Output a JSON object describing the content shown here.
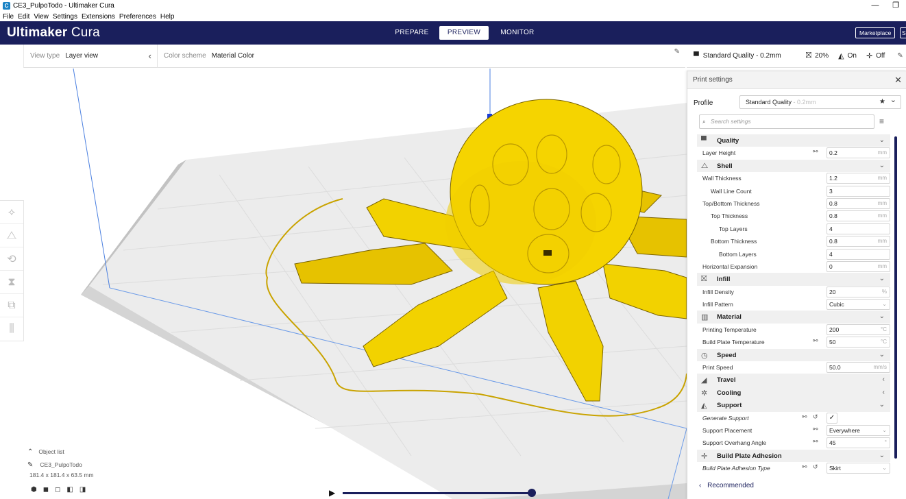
{
  "window": {
    "title": "CE3_PulpoTodo - Ultimaker Cura",
    "app_icon": "C",
    "minimize": "—",
    "restore": "❐"
  },
  "menu": [
    "File",
    "Edit",
    "View",
    "Settings",
    "Extensions",
    "Preferences",
    "Help"
  ],
  "header": {
    "logo_bold": "Ultimaker",
    "logo_light": " Cura",
    "stages": [
      "PREPARE",
      "PREVIEW",
      "MONITOR"
    ],
    "active_stage": "PREVIEW",
    "marketplace": "Marketplace",
    "signin": "S",
    "colors": {
      "bar": "#1a1f5c"
    }
  },
  "viewbar": {
    "view_type_label": "View type",
    "view_type_value": "Layer view",
    "chevron": "‹",
    "color_scheme_label": "Color scheme",
    "color_scheme_value": "Material Color",
    "edit_icon": "✎"
  },
  "quality_bar": {
    "profile": "Standard Quality - 0.2mm",
    "infill": "20%",
    "support": "On",
    "adhesion": "Off",
    "edit_icon": "✎"
  },
  "panel": {
    "title": "Print settings",
    "close": "✕",
    "profile_label": "Profile",
    "profile_value": "Standard Quality",
    "profile_suffix": " - 0.2mm",
    "star": "★",
    "chevron": "⌄",
    "search_placeholder": "Search settings",
    "menu_icon": "≡",
    "recommended": "Recommended",
    "recommended_chevron": "‹"
  },
  "settings": [
    {
      "type": "cat",
      "label": "Quality",
      "icon": "quality-icon",
      "glyph": "▀",
      "chev": "⌄"
    },
    {
      "type": "row",
      "label": "Layer Height",
      "indent": 0,
      "value": "0.2",
      "unit": "mm",
      "link": true
    },
    {
      "type": "cat",
      "label": "Shell",
      "icon": "shell-icon",
      "glyph": "⧍",
      "chev": "⌄"
    },
    {
      "type": "row",
      "label": "Wall Thickness",
      "indent": 0,
      "value": "1.2",
      "unit": "mm"
    },
    {
      "type": "row",
      "label": "Wall Line Count",
      "indent": 1,
      "value": "3",
      "unit": ""
    },
    {
      "type": "row",
      "label": "Top/Bottom Thickness",
      "indent": 0,
      "value": "0.8",
      "unit": "mm"
    },
    {
      "type": "row",
      "label": "Top Thickness",
      "indent": 1,
      "value": "0.8",
      "unit": "mm"
    },
    {
      "type": "row",
      "label": "Top Layers",
      "indent": 2,
      "value": "4",
      "unit": ""
    },
    {
      "type": "row",
      "label": "Bottom Thickness",
      "indent": 1,
      "value": "0.8",
      "unit": "mm"
    },
    {
      "type": "row",
      "label": "Bottom Layers",
      "indent": 2,
      "value": "4",
      "unit": ""
    },
    {
      "type": "row",
      "label": "Horizontal Expansion",
      "indent": 0,
      "value": "0",
      "unit": "mm"
    },
    {
      "type": "cat",
      "label": "Infill",
      "icon": "infill-icon",
      "glyph": "⛝",
      "chev": "⌄"
    },
    {
      "type": "row",
      "label": "Infill Density",
      "indent": 0,
      "value": "20",
      "unit": "%"
    },
    {
      "type": "row",
      "label": "Infill Pattern",
      "indent": 0,
      "value": "Cubic",
      "unit": "⌄"
    },
    {
      "type": "cat",
      "label": "Material",
      "icon": "material-icon",
      "glyph": "▥",
      "chev": "⌄"
    },
    {
      "type": "row",
      "label": "Printing Temperature",
      "indent": 0,
      "value": "200",
      "unit": "°C"
    },
    {
      "type": "row",
      "label": "Build Plate Temperature",
      "indent": 0,
      "value": "50",
      "unit": "°C",
      "link": true
    },
    {
      "type": "cat",
      "label": "Speed",
      "icon": "speed-icon",
      "glyph": "◷",
      "chev": "⌄"
    },
    {
      "type": "row",
      "label": "Print Speed",
      "indent": 0,
      "value": "50.0",
      "unit": "mm/s"
    },
    {
      "type": "cat",
      "label": "Travel",
      "icon": "travel-icon",
      "glyph": "◢",
      "chev": "‹"
    },
    {
      "type": "cat",
      "label": "Cooling",
      "icon": "cooling-icon",
      "glyph": "✲",
      "chev": "‹"
    },
    {
      "type": "cat",
      "label": "Support",
      "icon": "support-icon",
      "glyph": "◭",
      "chev": "⌄"
    },
    {
      "type": "row",
      "label": "Generate Support",
      "indent": 0,
      "value": "✓",
      "unit": "",
      "italic": true,
      "link": true,
      "reset": true,
      "checkbox": true
    },
    {
      "type": "row",
      "label": "Support Placement",
      "indent": 0,
      "value": "Everywhere",
      "unit": "⌄",
      "link": true
    },
    {
      "type": "row",
      "label": "Support Overhang Angle",
      "indent": 0,
      "value": "45",
      "unit": "°",
      "link": true
    },
    {
      "type": "cat",
      "label": "Build Plate Adhesion",
      "icon": "adhesion-icon",
      "glyph": "✛",
      "chev": "⌄"
    },
    {
      "type": "row",
      "label": "Build Plate Adhesion Type",
      "indent": 0,
      "value": "Skirt",
      "unit": "⌄",
      "italic": true,
      "link": true,
      "reset": true
    }
  ],
  "object": {
    "list_label": "Object list",
    "name": "CE3_PulpoTodo",
    "dims": "181.4 x 181.4 x 63.5 mm"
  },
  "tools": [
    "move-tool-icon",
    "scale-tool-icon",
    "rotate-tool-icon",
    "mirror-tool-icon",
    "per-model-settings-icon",
    "support-blocker-icon"
  ]
}
